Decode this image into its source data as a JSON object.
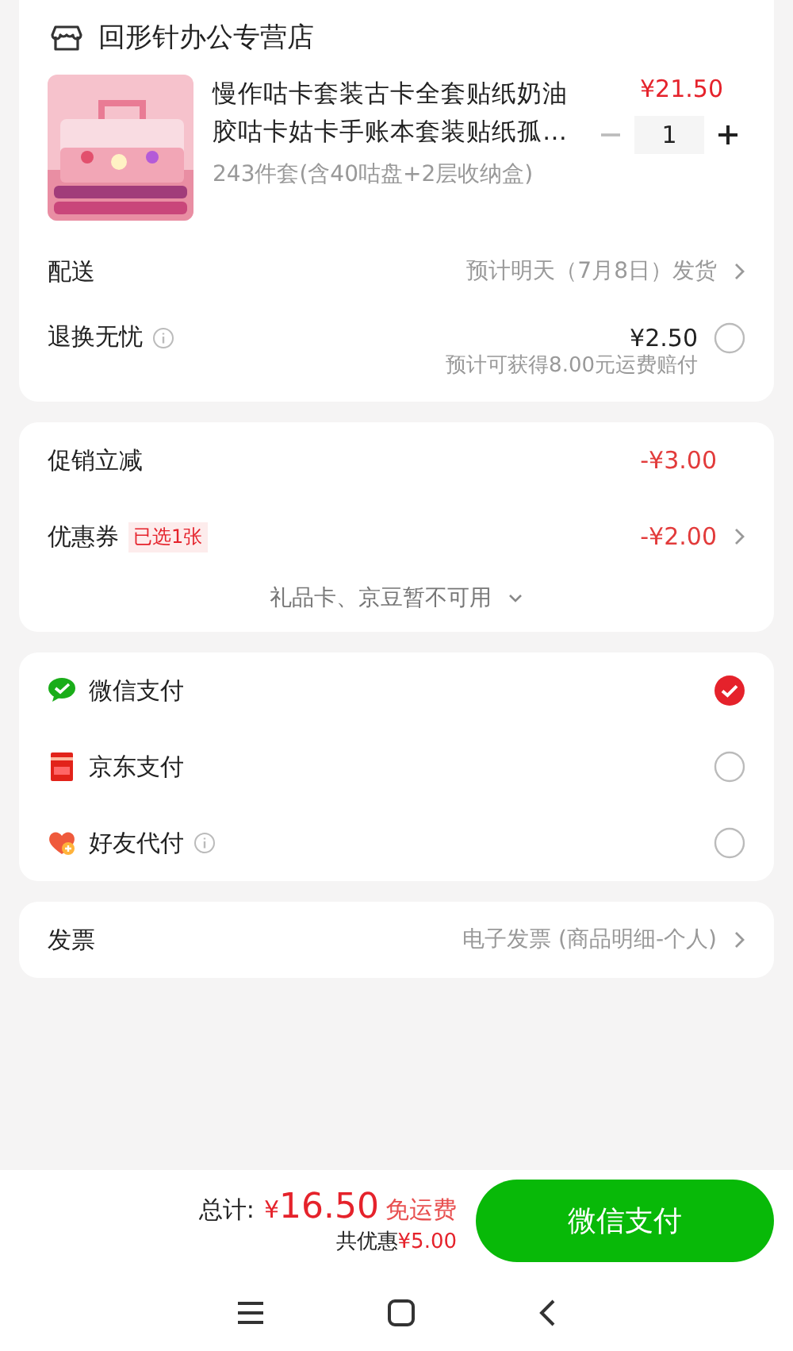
{
  "store": {
    "name": "回形针办公专营店"
  },
  "product": {
    "title": "慢作咕卡套装古卡全套贴纸奶油胶咕卡姑卡手账本套装贴纸孤…",
    "price": "¥21.50",
    "spec": "243件套(含40咕盘+2层收纳盒)",
    "quantity": "1",
    "decrease_disabled": true
  },
  "delivery": {
    "label": "配送",
    "value": "预计明天（7月8日）发货"
  },
  "return_service": {
    "label": "退换无忧",
    "price": "¥2.50",
    "note": "预计可获得8.00元运费赔付",
    "checked": false
  },
  "promotion": {
    "label": "促销立减",
    "value": "-¥3.00"
  },
  "coupon": {
    "label": "优惠券",
    "tag": "已选1张",
    "value": "-¥2.00"
  },
  "unavailable": {
    "text": "礼品卡、京豆暂不可用"
  },
  "payments": [
    {
      "kind": "wechat",
      "name": "微信支付",
      "info": false,
      "selected": true
    },
    {
      "kind": "jd",
      "name": "京东支付",
      "info": false,
      "selected": false
    },
    {
      "kind": "friend",
      "name": "好友代付",
      "info": true,
      "selected": false
    }
  ],
  "invoice": {
    "label": "发票",
    "value": "电子发票 (商品明细-个人)"
  },
  "footer": {
    "total_label": "总计:",
    "currency": "¥",
    "amount": "16.50",
    "shipping": "免运费",
    "saving_label": "共优惠",
    "saving": "¥5.00",
    "pay_button": "微信支付"
  }
}
